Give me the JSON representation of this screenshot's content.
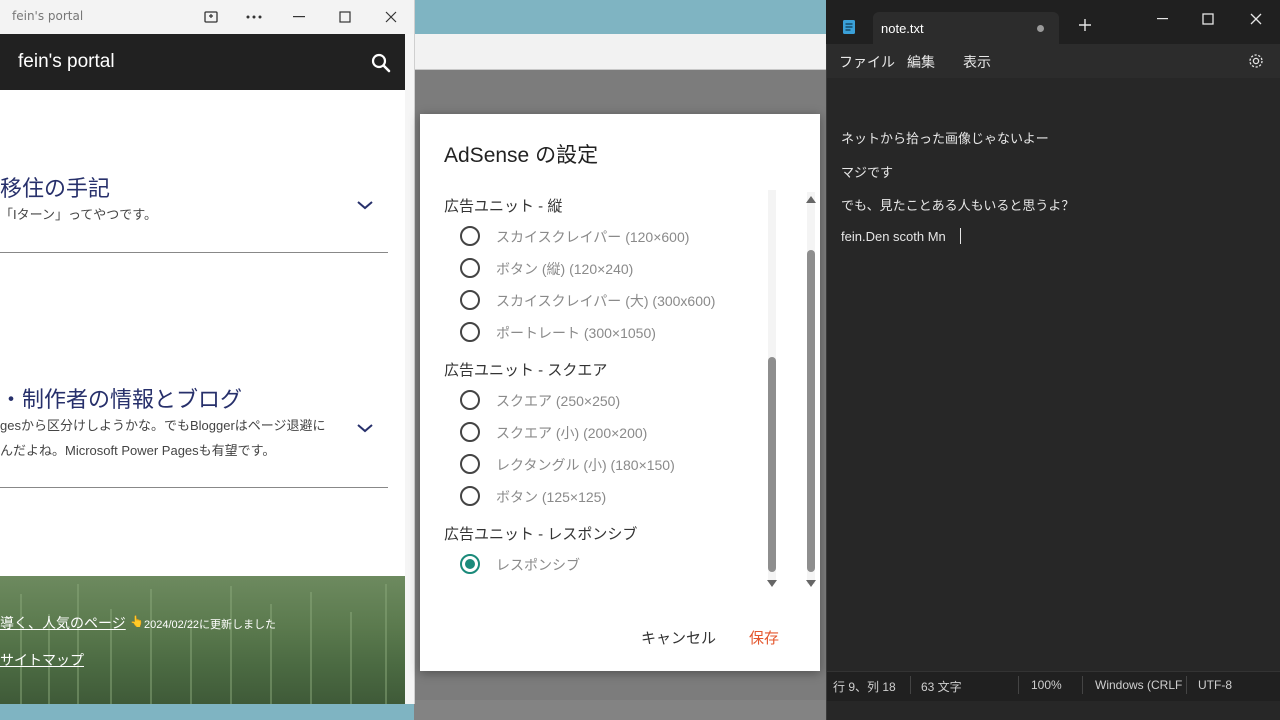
{
  "left_window": {
    "title": "fein's portal",
    "site_name": "fein's portal",
    "posts": [
      {
        "title": "移住の手記",
        "excerpt": "「Iターン」ってやつです。"
      },
      {
        "title": "・制作者の情報とブログ",
        "excerpt_line1": "gesから区分けしようかな。でもBloggerはページ退避に",
        "excerpt_line2": "んだよね。Microsoft Power Pagesも有望です。"
      }
    ],
    "footer": {
      "popular_link": "導く、人気のページ",
      "updated_icon": "👆",
      "updated_text": "2024/02/22に更新しました",
      "sitemap_link": "サイトマップ"
    }
  },
  "dialog": {
    "title": "AdSense の設定",
    "groups": [
      {
        "label": "広告ユニット - 縦",
        "options": [
          {
            "label": "スカイスクレイパー (120×600)",
            "selected": false
          },
          {
            "label": "ボタン (縦) (120×240)",
            "selected": false
          },
          {
            "label": "スカイスクレイパー (大) (300x600)",
            "selected": false
          },
          {
            "label": "ポートレート (300×1050)",
            "selected": false
          }
        ]
      },
      {
        "label": "広告ユニット - スクエア",
        "options": [
          {
            "label": "スクエア (250×250)",
            "selected": false
          },
          {
            "label": "スクエア (小) (200×200)",
            "selected": false
          },
          {
            "label": "レクタングル (小) (180×150)",
            "selected": false
          },
          {
            "label": "ボタン (125×125)",
            "selected": false
          }
        ]
      },
      {
        "label": "広告ユニット - レスポンシブ",
        "options": [
          {
            "label": "レスポンシブ",
            "selected": true
          }
        ]
      }
    ],
    "cancel_label": "キャンセル",
    "save_label": "保存",
    "colors": {
      "accent": "#1a8a7a",
      "save": "#e4572e"
    }
  },
  "notepad": {
    "tab_name": "note.txt",
    "menus": [
      "ファイル",
      "編集",
      "表示"
    ],
    "lines": [
      "ネットから拾った画像じゃないよー",
      "マジです",
      "でも、見たことある人もいると思うよ？",
      "fein.Den scoth Mn"
    ],
    "status": {
      "position": "行 9、列 18",
      "chars": "63 文字",
      "zoom": "100%",
      "line_ending": "Windows (CRLF",
      "encoding": "UTF-8"
    }
  }
}
